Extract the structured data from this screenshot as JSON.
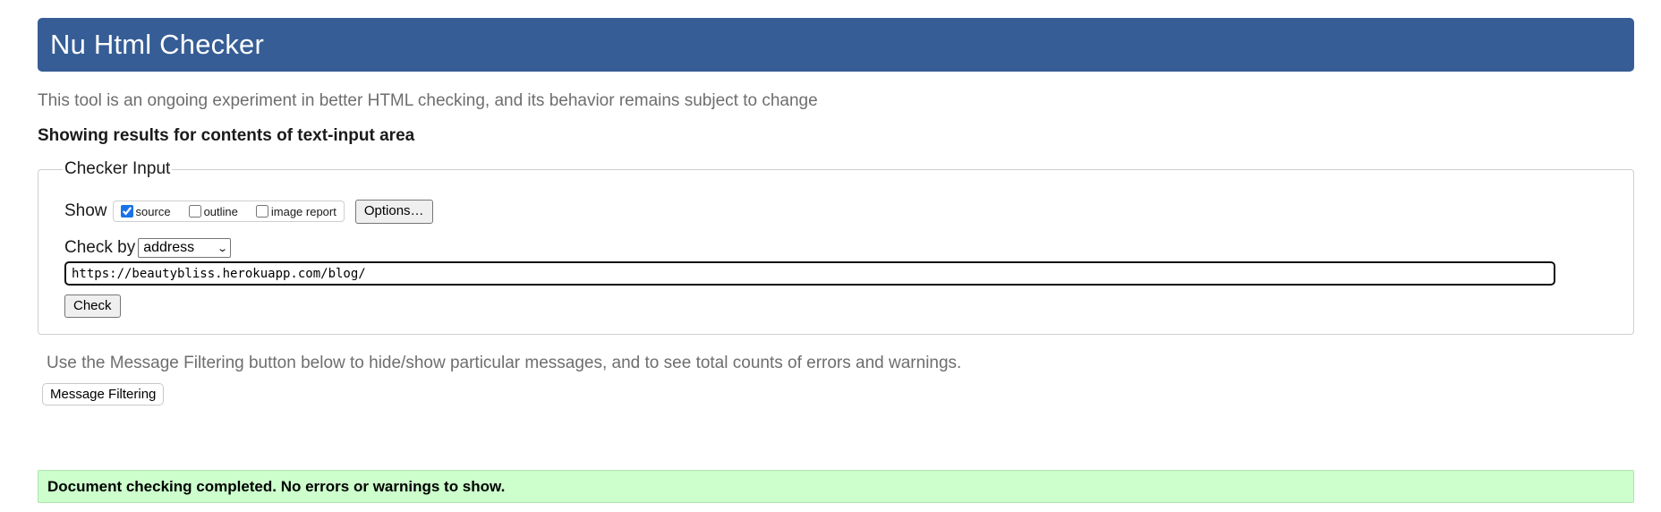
{
  "header": {
    "title": "Nu Html Checker",
    "background_color": "#365d95"
  },
  "tagline": "This tool is an ongoing experiment in better HTML checking, and its behavior remains subject to change",
  "showing_results": "Showing results for contents of text-input area",
  "checker_input": {
    "legend": "Checker Input",
    "show_label": "Show",
    "show_options": [
      {
        "label": "source",
        "checked": true
      },
      {
        "label": "outline",
        "checked": false
      },
      {
        "label": "image report",
        "checked": false
      }
    ],
    "options_button": "Options…",
    "check_by_label": "Check by",
    "check_by_selected": "address",
    "url_value": "https://beautybliss.herokuapp.com/blog/",
    "check_button": "Check"
  },
  "filter_note": "Use the Message Filtering button below to hide/show particular messages, and to see total counts of errors and warnings.",
  "message_filtering_button": "Message Filtering",
  "result": {
    "message": "Document checking completed. No errors or warnings to show.",
    "background_color": "#ccffcc"
  }
}
